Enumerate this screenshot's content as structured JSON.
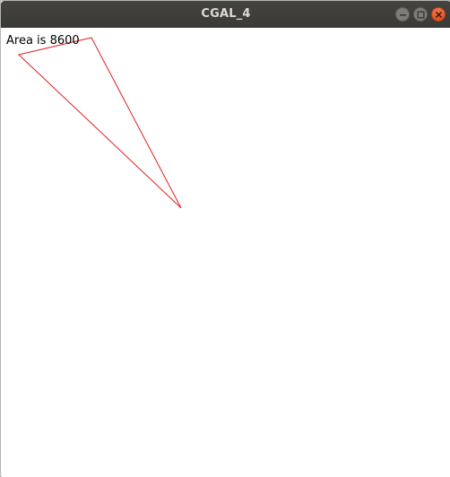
{
  "window": {
    "title": "CGAL_4",
    "controls": {
      "minimize_icon": "minimize-icon",
      "maximize_icon": "maximize-icon",
      "close_icon": "close-icon"
    },
    "close_color": "#e95420"
  },
  "canvas": {
    "label": "Area is 8600",
    "background": "#ffffff",
    "shape": {
      "type": "triangle",
      "stroke": "#e02020"
    }
  }
}
